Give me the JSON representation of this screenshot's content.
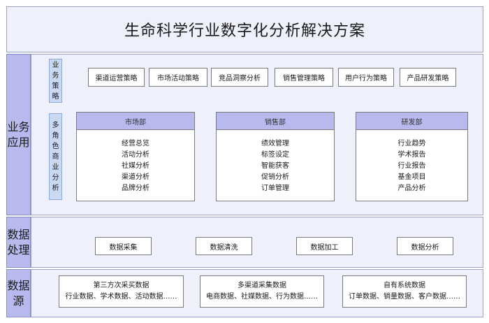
{
  "title": "生命科学行业数字化分析解决方案",
  "layers": {
    "business": {
      "label": [
        "业务",
        "应用"
      ]
    },
    "processing": {
      "label": [
        "数据",
        "处理"
      ]
    },
    "source": {
      "label": [
        "数据",
        "源"
      ]
    }
  },
  "strategy": {
    "label": [
      "业",
      "务",
      "策",
      "略"
    ],
    "items": [
      "渠道运营策略",
      "市场活动策略",
      "竞品洞察分析",
      "销售管理策略",
      "用户行为策略",
      "产品研发策略"
    ]
  },
  "analysis": {
    "label": [
      "多",
      "角",
      "色",
      "商",
      "业",
      "分",
      "析"
    ],
    "departments": [
      {
        "name": "市场部",
        "items": [
          "经营总览",
          "活动分析",
          "社媒分析",
          "渠道分析",
          "品牌分析"
        ]
      },
      {
        "name": "销售部",
        "items": [
          "绩效管理",
          "标签设定",
          "智能获客",
          "促销分析",
          "订单管理"
        ]
      },
      {
        "name": "研发部",
        "items": [
          "行业趋势",
          "学术报告",
          "行业报告",
          "基金项目",
          "产品分析"
        ]
      }
    ]
  },
  "processing": [
    "数据采集",
    "数据清洗",
    "数据加工",
    "数据分析"
  ],
  "sources": [
    {
      "name": "第三方次采买数据",
      "detail": "行业数据、学术数据、活动数据……"
    },
    {
      "name": "多渠道采集数据",
      "detail": "电商数据、社媒数据、行为数据……"
    },
    {
      "name": "自有系统数据",
      "detail": "订单数据、销量数据、客户数据……"
    }
  ]
}
